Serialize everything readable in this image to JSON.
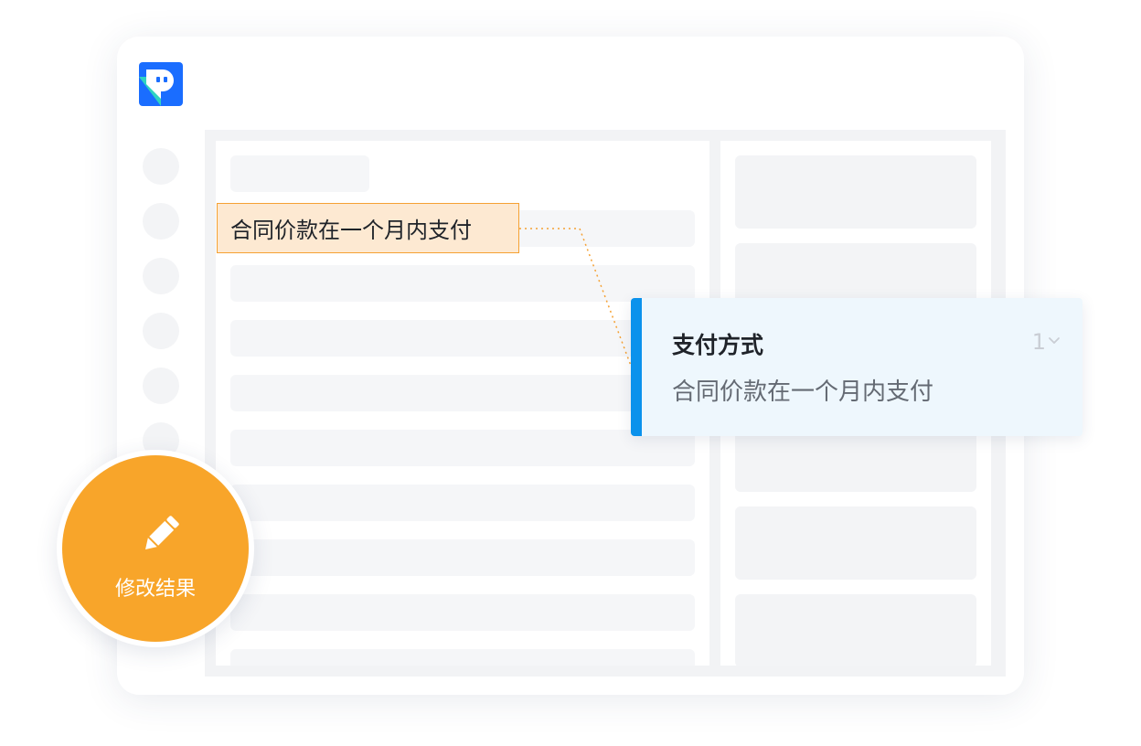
{
  "app": {
    "logo_icon": "app-logo-icon"
  },
  "nav": {
    "item_count": 6
  },
  "document": {
    "highlighted_text": "合同价款在一个月内支付"
  },
  "result": {
    "title": "支付方式",
    "value": "合同价款在一个月内支付",
    "count": "1",
    "expand_icon": "chevron-down-icon"
  },
  "edit_button": {
    "label": "修改结果",
    "icon": "pencil-icon"
  },
  "colors": {
    "accent_blue": "#0b92ec",
    "brand_blue": "#1a6dff",
    "highlight_orange": "#f5a133",
    "button_orange": "#f8a52a"
  }
}
